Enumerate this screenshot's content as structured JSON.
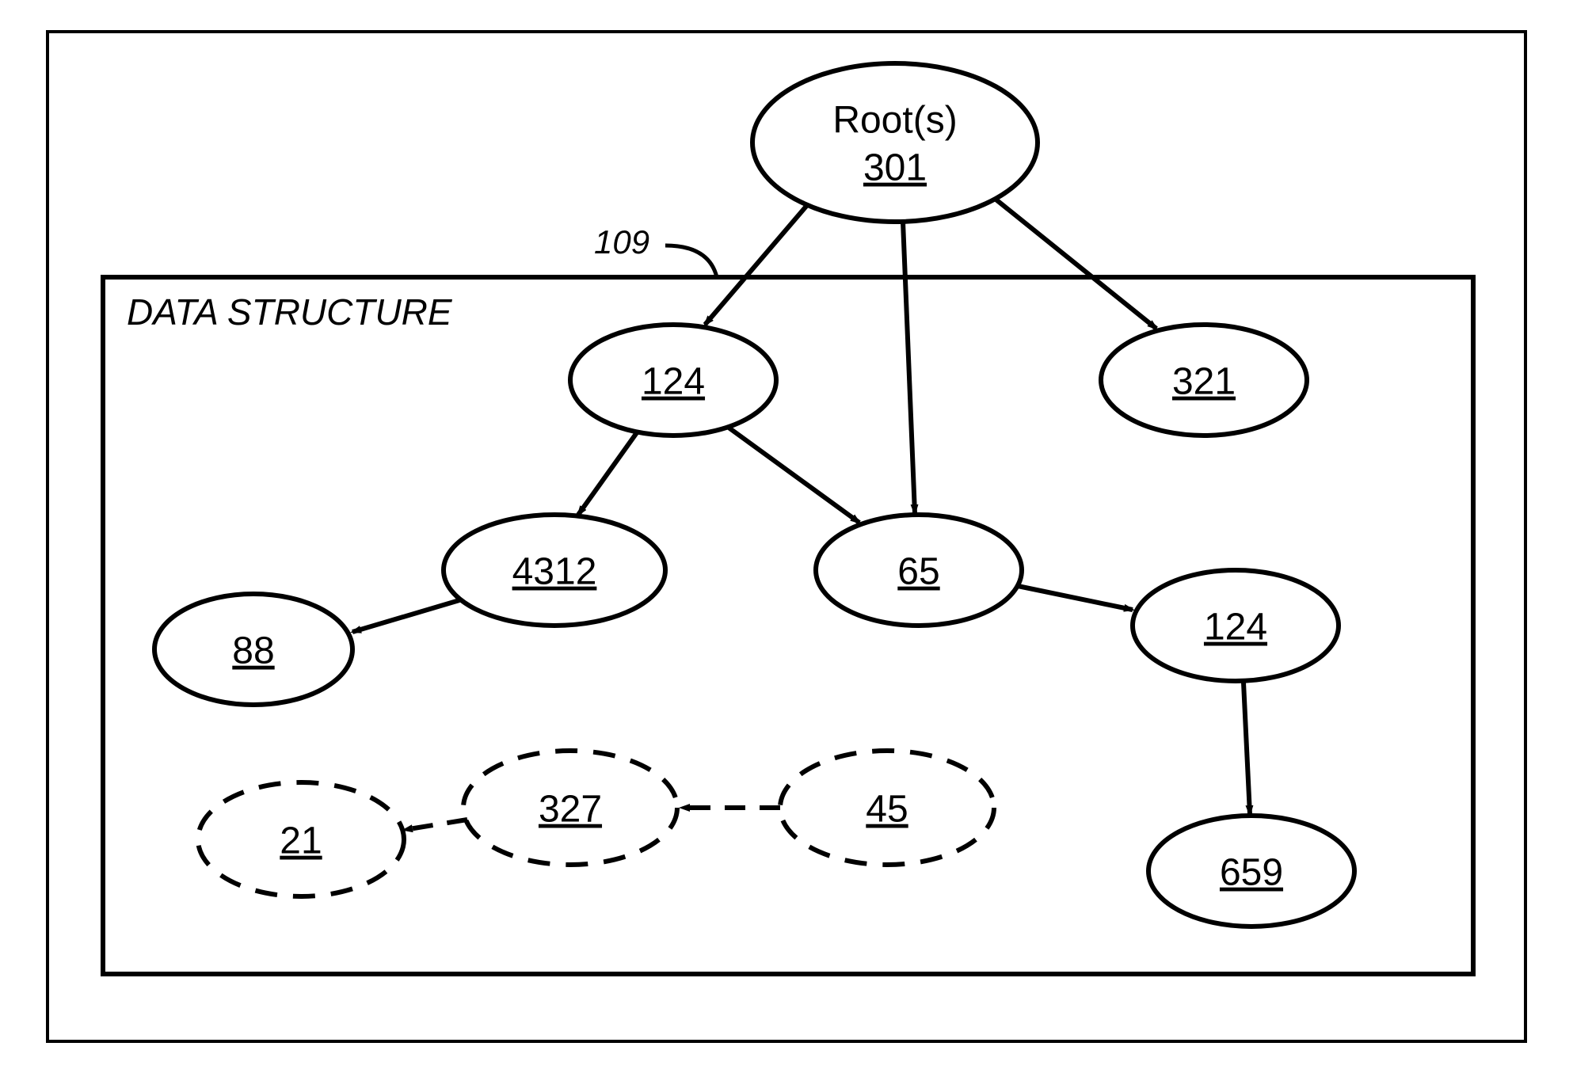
{
  "diagram": {
    "box_title": "DATA STRUCTURE",
    "ref_label": "109",
    "root": {
      "title": "Root(s)",
      "id": "301"
    },
    "nodes": {
      "n124a": "124",
      "n321": "321",
      "n4312": "4312",
      "n65": "65",
      "n88": "88",
      "n124b": "124",
      "n659": "659",
      "n327": "327",
      "n45": "45",
      "n21": "21"
    }
  }
}
